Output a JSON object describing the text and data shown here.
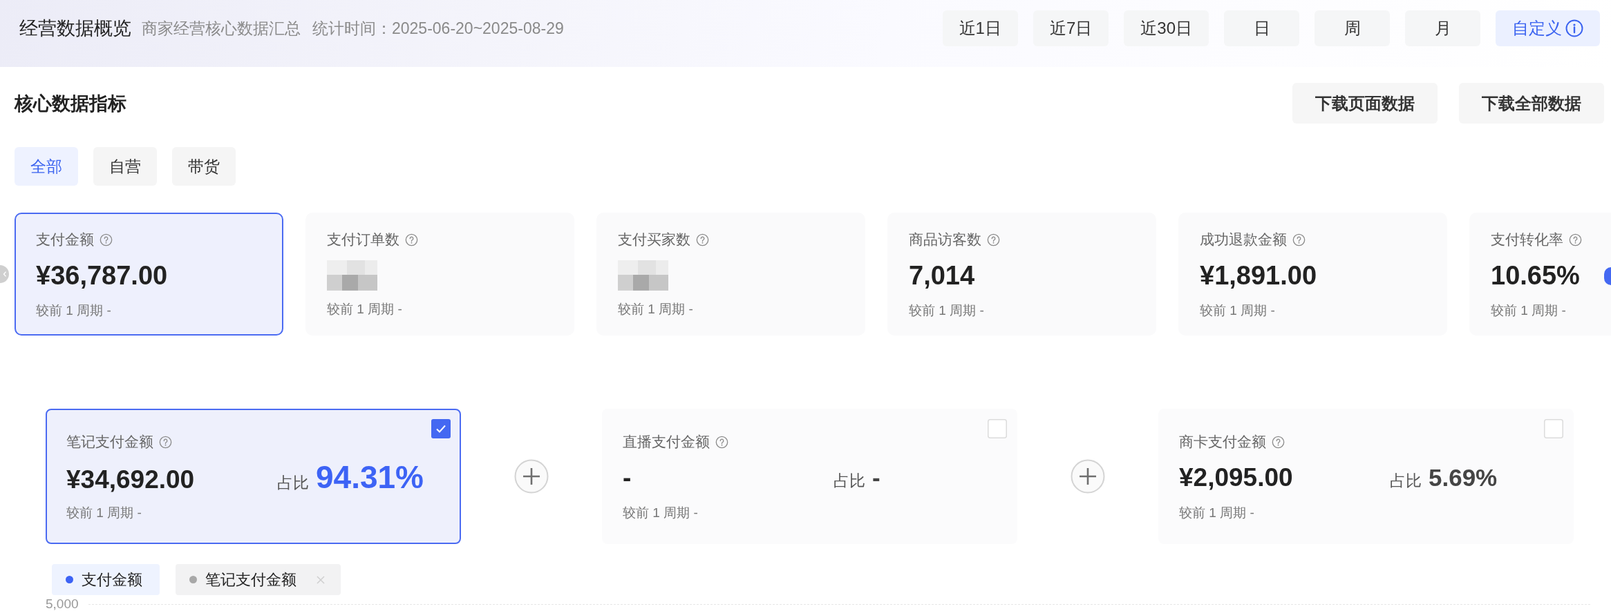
{
  "header": {
    "title": "经营数据概览",
    "subtitle": "商家经营核心数据汇总",
    "period": "统计时间：2025-06-20~2025-08-29"
  },
  "date_ranges": [
    {
      "label": "近1日",
      "kind": "preset",
      "selected": false
    },
    {
      "label": "近7日",
      "kind": "preset",
      "selected": false
    },
    {
      "label": "近30日",
      "kind": "preset",
      "selected": false
    },
    {
      "label": "日",
      "kind": "preset",
      "selected": false
    },
    {
      "label": "周",
      "kind": "preset",
      "selected": false
    },
    {
      "label": "月",
      "kind": "preset",
      "selected": false
    },
    {
      "label": "自定义",
      "kind": "custom",
      "selected": true
    }
  ],
  "section": {
    "title": "核心数据指标",
    "actions": [
      "下载页面数据",
      "下载全部数据"
    ]
  },
  "channel_tabs": [
    {
      "label": "全部",
      "selected": true
    },
    {
      "label": "自营",
      "selected": false
    },
    {
      "label": "带货",
      "selected": false
    }
  ],
  "metrics": [
    {
      "label": "支付金额",
      "value": "¥36,787.00",
      "masked": false,
      "comparison": "较前 1 周期 -",
      "selected": true
    },
    {
      "label": "支付订单数",
      "masked": true,
      "comparison": "较前 1 周期 -",
      "selected": false
    },
    {
      "label": "支付买家数",
      "masked": true,
      "comparison": "较前 1 周期 -",
      "selected": false
    },
    {
      "label": "商品访客数",
      "value": "7,014",
      "masked": false,
      "comparison": "较前 1 周期 -",
      "selected": false
    },
    {
      "label": "成功退款金额",
      "value": "¥1,891.00",
      "masked": false,
      "comparison": "较前 1 周期 -",
      "selected": false
    },
    {
      "label": "支付转化率",
      "value": "10.65%",
      "masked": false,
      "comparison": "较前 1 周期 -",
      "selected": false
    }
  ],
  "breakdown": [
    {
      "label": "笔记支付金额",
      "value": "¥34,692.00",
      "share_label": "占比",
      "share": "94.31%",
      "comparison": "较前 1 周期 -",
      "checked": true
    },
    {
      "label": "直播支付金额",
      "value": "-",
      "share_label": "占比",
      "share": "-",
      "comparison": "较前 1 周期 -",
      "checked": false
    },
    {
      "label": "商卡支付金额",
      "value": "¥2,095.00",
      "share_label": "占比",
      "share": "5.69%",
      "comparison": "较前 1 周期 -",
      "checked": false
    }
  ],
  "legend": [
    {
      "label": "支付金额",
      "kind": "base",
      "color": "#3d63f5"
    },
    {
      "label": "笔记支付金额",
      "kind": "compare",
      "color": "#a8a8a8"
    }
  ],
  "chart": {
    "y_tick": "5,000"
  }
}
